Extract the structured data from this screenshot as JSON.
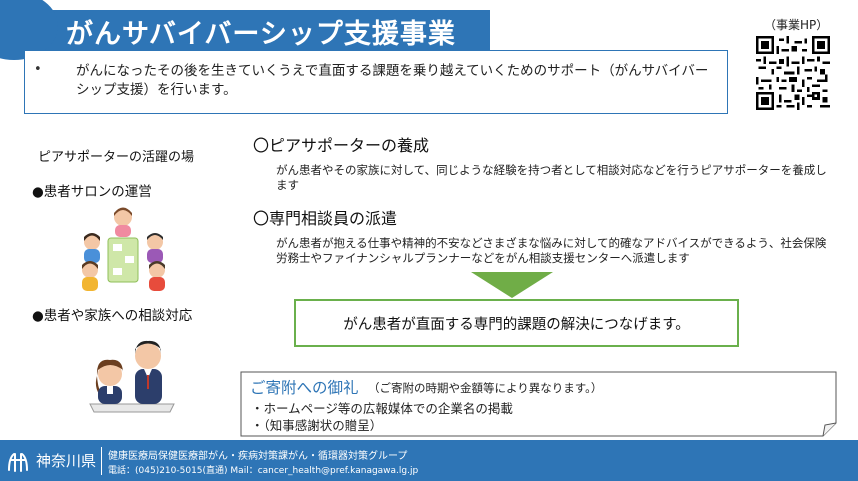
{
  "header": {
    "title": "がんサバイバーシップ支援事業",
    "summary_bullet": "•",
    "summary": "がんになったその後を生きていくうえで直面する課題を乗り越えていくためのサポート（がんサバイバーシップ支援）を行います。",
    "hp_label": "（事業HP）"
  },
  "left": {
    "heading": "ピアサポーターの活躍の場",
    "salon": "●患者サロンの運営",
    "consult": "●患者や家族への相談対応"
  },
  "sections": [
    {
      "title": "〇ピアサポーターの養成",
      "desc": "がん患者やその家族に対して、同じような経験を持つ者として相談対応などを行うピアサポーターを養成します"
    },
    {
      "title": "〇専門相談員の派遣",
      "desc": "がん患者が抱える仕事や精神的不安などさまざまな悩みに対して的確なアドバイスができるよう、社会保険労務士やファイナンシャルプランナーなどをがん相談支援センターへ派遣します"
    }
  ],
  "result": "がん患者が直面する専門的課題の解決につなげます。",
  "donation": {
    "title": "ご寄附への御礼",
    "note": "（ご寄附の時期や金額等により異なります。）",
    "items": [
      "・ホームページ等の広報媒体での企業名の掲載",
      "・（知事感謝状の贈呈）"
    ]
  },
  "footer": {
    "pref": "神奈川県",
    "dept": "健康医療局保健医療部がん・疾病対策課がん・循環器対策グループ",
    "contact": "電話：(045)210-5015(直通) Mail：cancer_health@pref.kanagawa.lg.jp"
  },
  "colors": {
    "primary": "#2e75b6",
    "accent_green": "#6ab04c"
  },
  "icons": [
    "qr-code-icon",
    "kanagawa-logo-icon",
    "down-arrow-icon"
  ]
}
